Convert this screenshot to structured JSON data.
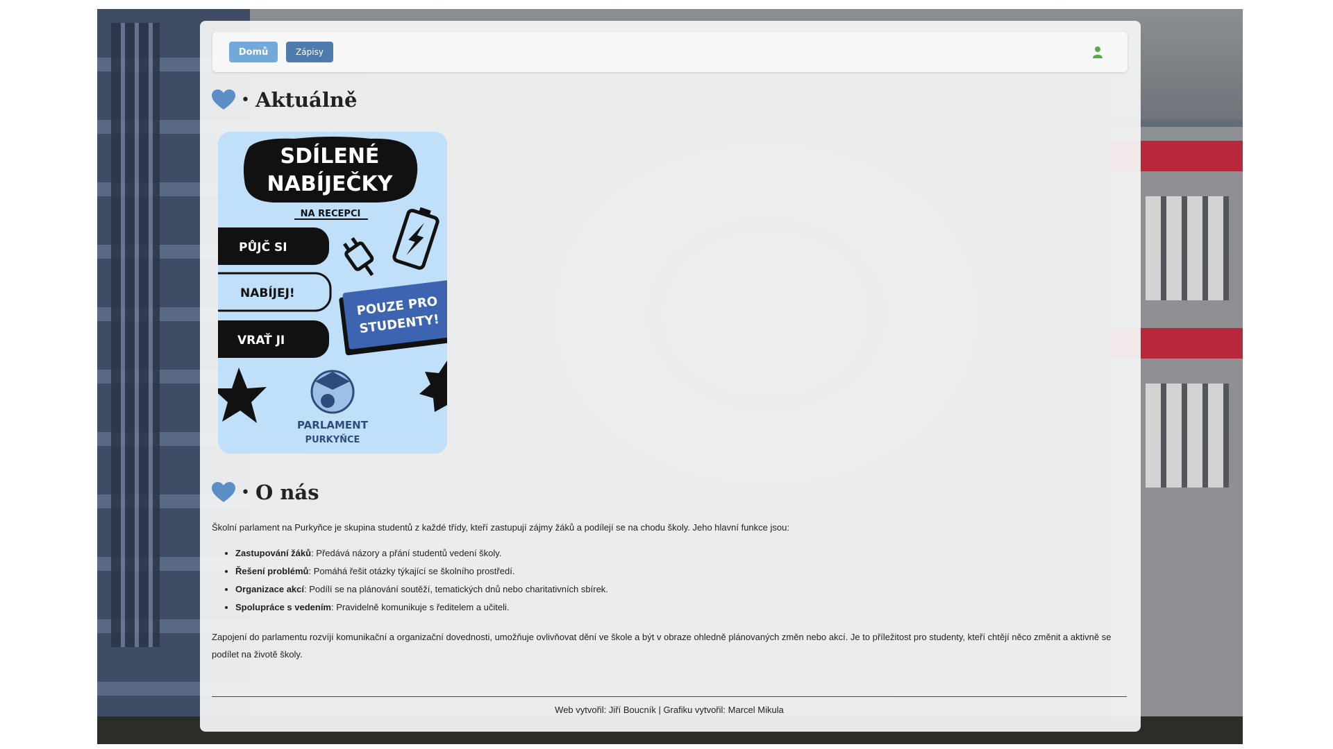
{
  "nav": {
    "home_label": "Domů",
    "zapisy_label": "Zápisy",
    "user_icon": "user-icon"
  },
  "colors": {
    "home_button": "#72a8da",
    "zapisy_button": "#4e7bab",
    "heart": "#5b8ec4",
    "user_icon": "#5aa84a",
    "poster_bg": "#bfe0f8"
  },
  "sections": {
    "news": {
      "icon": "heart-icon",
      "separator": "•",
      "title": "Aktuálně"
    },
    "about": {
      "icon": "heart-icon",
      "separator": "•",
      "title": "O nás"
    }
  },
  "poster": {
    "headline_line1": "SDÍLENÉ",
    "headline_line2": "NABÍJEČKY",
    "subtitle": "NA RECEPCI",
    "step1": "PŮJČ SI",
    "step2": "NABÍJEJ!",
    "step3": "VRAŤ JI",
    "badge_line1": "POUZE PRO",
    "badge_line2": "STUDENTY!",
    "logo_line1": "PARLAMENT",
    "logo_line2": "PURKYŇCE"
  },
  "about": {
    "intro": "Školní parlament na Purkyňce je skupina studentů z každé třídy, kteří zastupují zájmy žáků a podílejí se na chodu školy. Jeho hlavní funkce jsou:",
    "functions": [
      {
        "term": "Zastupování žáků",
        "desc": ": Předává názory a přání studentů vedení školy."
      },
      {
        "term": "Řešení problémů",
        "desc": ": Pomáhá řešit otázky týkající se školního prostředí."
      },
      {
        "term": "Organizace akcí",
        "desc": ": Podílí se na plánování soutěží, tematických dnů nebo charitativních sbírek."
      },
      {
        "term": "Spolupráce s vedením",
        "desc": ": Pravidelně komunikuje s ředitelem a učiteli."
      }
    ],
    "outro": "Zapojení do parlamentu rozvíjí komunikační a organizační dovednosti, umožňuje ovlivňovat dění ve škole a být v obraze ohledně plánovaných změn nebo akcí. Je to příležitost pro studenty, kteří chtějí něco změnit a aktivně se podílet na životě školy."
  },
  "footer": {
    "text": "Web vytvořil: Jiří Boucník | Grafiku vytvořil: Marcel Mikula"
  }
}
